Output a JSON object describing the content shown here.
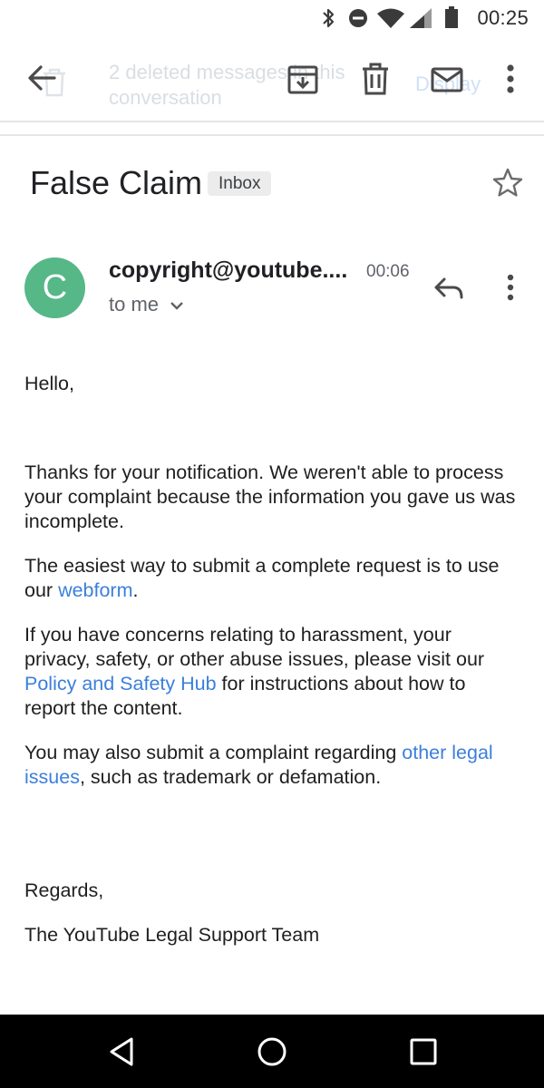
{
  "status_bar": {
    "time": "00:25",
    "icons": [
      "bluetooth-icon",
      "do-not-disturb-icon",
      "wifi-icon",
      "signal-icon",
      "battery-icon"
    ]
  },
  "toolbar": {
    "ghost_message_line1": "2 deleted messages in this",
    "ghost_message_line2": "conversation",
    "ghost_display": "Display",
    "icons": [
      "back-arrow-icon",
      "archive-icon",
      "trash-icon",
      "mail-icon",
      "more-vert-icon"
    ]
  },
  "email": {
    "subject": "False Claim",
    "label": "Inbox",
    "sender_initial": "C",
    "sender": "copyright@youtube....",
    "time": "00:06",
    "recipient": "to me",
    "greeting": "Hello,",
    "para1": "Thanks for your notification. We weren't able to process your complaint because the information you gave us was incomplete.",
    "para2_pre": "The easiest way to submit a complete request is to use our ",
    "para2_link": "webform",
    "para2_post": ".",
    "para3_pre": "If you have concerns relating to harassment, your privacy, safety, or other abuse issues, please visit our ",
    "para3_link": "Policy and Safety Hub",
    "para3_post": " for instructions about how to report the content.",
    "para4_pre": "You may also submit a complaint regarding ",
    "para4_link": "other legal issues",
    "para4_post": ", such as trademark or defamation.",
    "closing": "Regards,",
    "signature": "The YouTube Legal Support Team"
  },
  "colors": {
    "avatar": "#56b787",
    "link": "#3b7fdc",
    "nav_bar": "#000000"
  }
}
